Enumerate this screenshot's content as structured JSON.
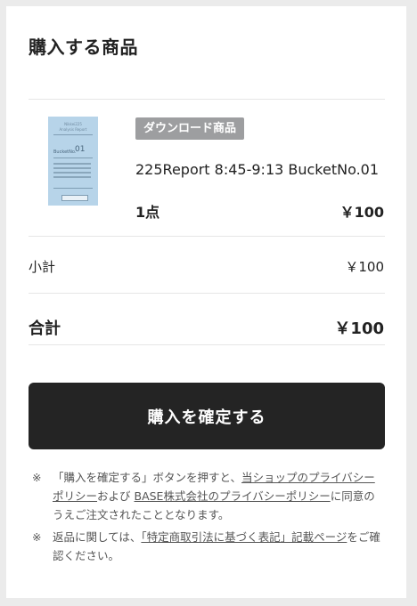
{
  "header": {
    "title": "購入する商品"
  },
  "item": {
    "thumbnail": {
      "title_line1": "Nikkei225",
      "title_line2": "Analysis Report",
      "bucket_label": "BucketNo.",
      "bucket_number": "01"
    },
    "badge": "ダウンロード商品",
    "name": "225Report 8:45-9:13 BucketNo.01",
    "quantity": "1点",
    "price": "￥100"
  },
  "summary": {
    "subtotal_label": "小計",
    "subtotal_value": "￥100",
    "total_label": "合計",
    "total_value": "￥100"
  },
  "confirm_button": {
    "label": "購入を確定する"
  },
  "notes": {
    "mark": "※",
    "note1": {
      "prefix": "「購入を確定する」ボタンを押すと、",
      "link1": "当ショップのプライバシーポリシー",
      "mid": "および ",
      "link2": "BASE株式会社のプライバシーポリシー",
      "suffix": "に同意のうえご注文されたこととなります。"
    },
    "note2": {
      "prefix": "返品に関しては、",
      "link": "「特定商取引法に基づく表記」記載ページ",
      "suffix": "をご確認ください。"
    }
  }
}
